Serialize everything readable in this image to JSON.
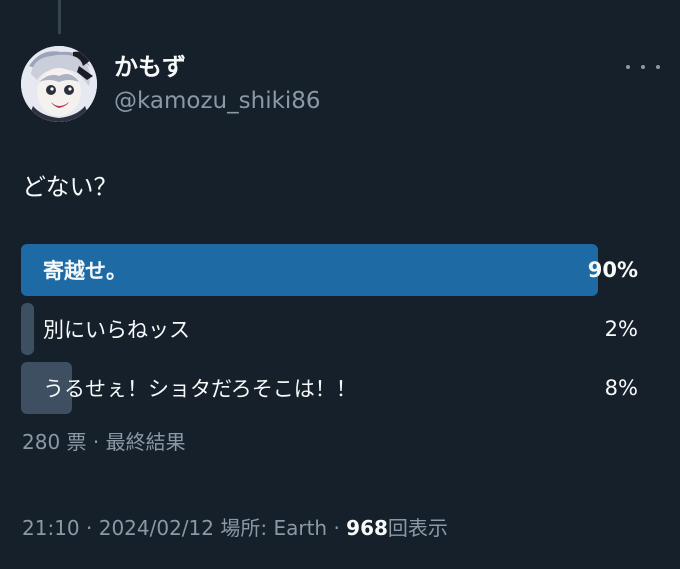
{
  "author": {
    "display_name": "かもず",
    "handle": "@kamozu_shiki86",
    "avatar_icon": "user-avatar-icon"
  },
  "tweet": {
    "text": "どない？"
  },
  "poll": {
    "options": [
      {
        "label": "寄越せ。",
        "percent_text": "90%",
        "percent": 90,
        "winner": true
      },
      {
        "label": "別にいらねッス",
        "percent_text": "2%",
        "percent": 2,
        "winner": false
      },
      {
        "label": "うるせぇ！ショタだろそこは！！",
        "percent_text": "8%",
        "percent": 8,
        "winner": false
      }
    ],
    "votes": "280 票",
    "separator": " · ",
    "status": "最終結果"
  },
  "meta": {
    "time": "21:10",
    "separator": " · ",
    "date": "2024/02/12",
    "location_label": "場所: Earth",
    "views_count": "968",
    "views_label": "回表示"
  },
  "colors": {
    "background": "#15202b",
    "winner_bar": "#1d6aa5",
    "other_bar": "#3d4f60",
    "secondary_text": "#8b98a5"
  }
}
